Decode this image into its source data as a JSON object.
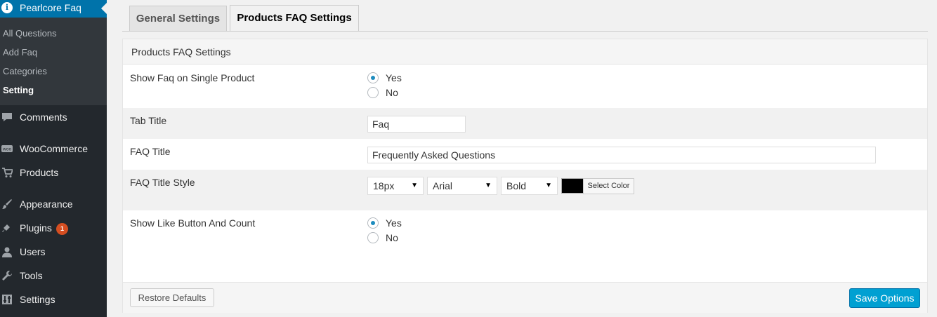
{
  "sidebar": {
    "plugin_title": "Pearlcore Faq",
    "submenu": [
      "All Questions",
      "Add Faq",
      "Categories",
      "Setting"
    ],
    "current_submenu": "Setting",
    "items": [
      {
        "label": "Comments",
        "icon": "comment-icon"
      },
      {
        "label": "WooCommerce",
        "icon": "woocommerce-icon"
      },
      {
        "label": "Products",
        "icon": "cart-icon"
      },
      {
        "label": "Appearance",
        "icon": "brush-icon"
      },
      {
        "label": "Plugins",
        "icon": "plugin-icon",
        "badge": "1"
      },
      {
        "label": "Users",
        "icon": "user-icon"
      },
      {
        "label": "Tools",
        "icon": "wrench-icon"
      },
      {
        "label": "Settings",
        "icon": "settings-icon"
      }
    ]
  },
  "tabs": [
    {
      "label": "General Settings",
      "active": false
    },
    {
      "label": "Products FAQ Settings",
      "active": true
    }
  ],
  "panel": {
    "title": "Products FAQ Settings",
    "show_faq": {
      "label": "Show Faq on Single Product",
      "options": [
        "Yes",
        "No"
      ],
      "selected": "Yes"
    },
    "tab_title": {
      "label": "Tab Title",
      "value": "Faq"
    },
    "faq_title": {
      "label": "FAQ Title",
      "value": "Frequently Asked Questions"
    },
    "faq_title_style": {
      "label": "FAQ Title Style",
      "size": "18px",
      "font": "Arial",
      "weight": "Bold",
      "color": "#000000",
      "color_button": "Select Color"
    },
    "show_like": {
      "label": "Show Like Button And Count",
      "options": [
        "Yes",
        "No"
      ],
      "selected": "Yes"
    }
  },
  "footer": {
    "restore_label": "Restore Defaults",
    "save_label": "Save Options"
  },
  "colors": {
    "sidebar_bg": "#23282d",
    "accent": "#0073aa",
    "save_button": "#00a0d2",
    "badge": "#d54e21"
  }
}
